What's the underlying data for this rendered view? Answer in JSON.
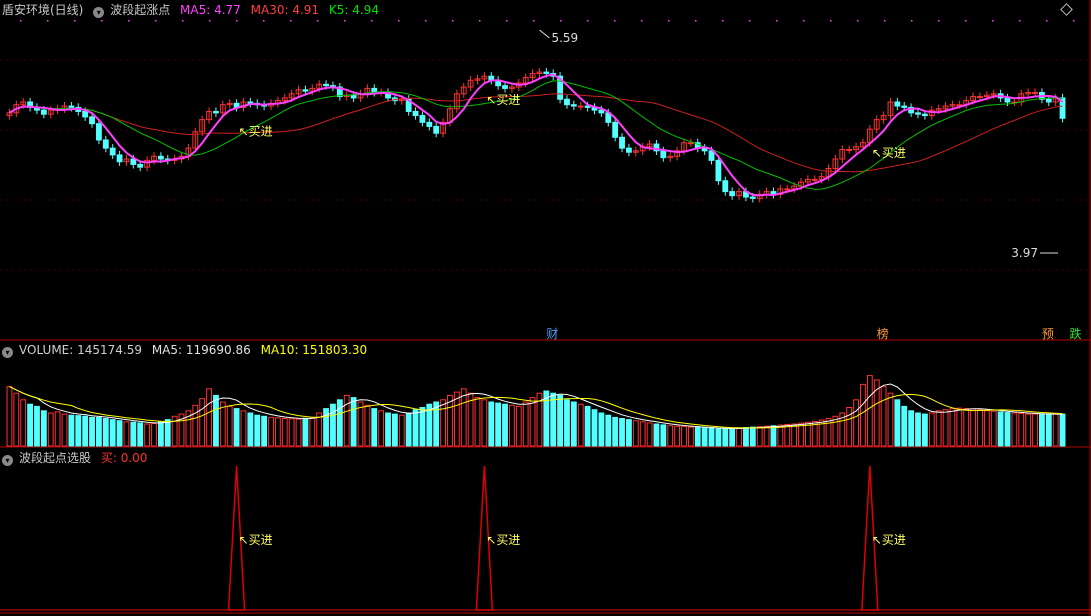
{
  "panels": {
    "main": {
      "stock_name": "盾安环境(日线)",
      "indicator_name": "波段起涨点",
      "ma5_label": "MA5: 4.77",
      "ma30_label": "MA30: 4.91",
      "k5_label": "K5: 4.94",
      "high_label": "5.59",
      "low_label": "3.97",
      "buy_label": "买进",
      "event_markers": [
        "财",
        "榜",
        "预",
        "跌"
      ]
    },
    "volume": {
      "vol_label": "VOLUME: 145174.59",
      "ma5_label": "MA5: 119690.86",
      "ma10_label": "MA10: 151803.30"
    },
    "signal": {
      "indicator_name": "波段起点选股",
      "value_label": "买: 0.00",
      "buy_label": "买进"
    }
  },
  "colors": {
    "up": "#ff3232",
    "down": "#54ffff",
    "ma5": "#ff40ff",
    "ma30": "#cc2020",
    "k5": "#00c000",
    "vol_ma5": "#ffffff",
    "vol_ma10": "#ffff00",
    "signal": "#e00000",
    "border": "#b40000"
  },
  "chart_data": {
    "type": "candlestick",
    "price_range": [
      3.97,
      5.59
    ],
    "price_high": 5.59,
    "price_low": 3.97,
    "volume_range": [
      0,
      400000
    ],
    "signal_range": [
      0,
      1
    ],
    "buy_signal_indices": [
      33,
      69,
      125
    ],
    "event_marker_indices": [
      78,
      126,
      150,
      154
    ],
    "closes": [
      4.98,
      5.04,
      5.06,
      5.02,
      5.0,
      4.97,
      5.0,
      5.01,
      5.03,
      5.02,
      4.99,
      4.95,
      4.9,
      4.78,
      4.72,
      4.67,
      4.62,
      4.64,
      4.6,
      4.58,
      4.63,
      4.66,
      4.64,
      4.63,
      4.64,
      4.66,
      4.72,
      4.84,
      4.93,
      4.99,
      4.98,
      5.04,
      5.05,
      5.02,
      5.06,
      5.05,
      5.04,
      5.03,
      5.05,
      5.07,
      5.09,
      5.12,
      5.15,
      5.14,
      5.16,
      5.19,
      5.18,
      5.17,
      5.1,
      5.11,
      5.09,
      5.12,
      5.16,
      5.13,
      5.13,
      5.09,
      5.07,
      5.08,
      4.99,
      4.96,
      4.91,
      4.88,
      4.83,
      4.91,
      5.01,
      5.12,
      5.17,
      5.22,
      5.23,
      5.25,
      5.22,
      5.18,
      5.16,
      5.17,
      5.2,
      5.24,
      5.27,
      5.28,
      5.27,
      5.25,
      5.08,
      5.04,
      5.03,
      5.03,
      5.02,
      5.0,
      4.98,
      4.91,
      4.8,
      4.72,
      4.69,
      4.7,
      4.73,
      4.75,
      4.7,
      4.65,
      4.66,
      4.7,
      4.76,
      4.76,
      4.72,
      4.7,
      4.63,
      4.48,
      4.4,
      4.37,
      4.4,
      4.36,
      4.35,
      4.38,
      4.4,
      4.38,
      4.42,
      4.42,
      4.44,
      4.47,
      4.49,
      4.49,
      4.51,
      4.57,
      4.64,
      4.71,
      4.71,
      4.73,
      4.76,
      4.86,
      4.93,
      4.96,
      5.06,
      5.03,
      5.02,
      4.98,
      4.97,
      4.96,
      5.0,
      5.01,
      5.03,
      5.04,
      5.04,
      5.07,
      5.1,
      5.1,
      5.11,
      5.12,
      5.09,
      5.06,
      5.06,
      5.12,
      5.13,
      5.13,
      5.08,
      5.06,
      5.09,
      4.94
    ],
    "volumes": [
      270000,
      240000,
      210000,
      190000,
      180000,
      160000,
      150000,
      155000,
      145000,
      140000,
      138000,
      135000,
      130000,
      130000,
      125000,
      120000,
      115000,
      110000,
      108000,
      105000,
      100000,
      102000,
      110000,
      120000,
      135000,
      145000,
      160000,
      185000,
      215000,
      260000,
      230000,
      200000,
      180000,
      170000,
      160000,
      150000,
      140000,
      135000,
      130000,
      128000,
      125000,
      124000,
      122000,
      126000,
      130000,
      150000,
      170000,
      190000,
      210000,
      230000,
      220000,
      200000,
      185000,
      170000,
      160000,
      150000,
      145000,
      140000,
      150000,
      165000,
      175000,
      190000,
      200000,
      210000,
      230000,
      245000,
      260000,
      240000,
      220000,
      210000,
      200000,
      195000,
      190000,
      185000,
      180000,
      200000,
      220000,
      240000,
      250000,
      240000,
      230000,
      210000,
      200000,
      190000,
      180000,
      165000,
      150000,
      140000,
      130000,
      125000,
      120000,
      115000,
      110000,
      105000,
      100000,
      96000,
      92000,
      90000,
      88000,
      86000,
      84000,
      82000,
      80000,
      78000,
      78000,
      80000,
      82000,
      84000,
      86000,
      88000,
      90000,
      92000,
      95000,
      98000,
      100000,
      104000,
      108000,
      112000,
      118000,
      125000,
      135000,
      150000,
      175000,
      210000,
      280000,
      320000,
      300000,
      270000,
      240000,
      210000,
      180000,
      160000,
      150000,
      145000,
      150000,
      160000,
      165000,
      170000,
      172000,
      170000,
      168000,
      165000,
      160000,
      158000,
      155000,
      152000,
      150000,
      148000,
      145000,
      145000,
      145000,
      145000,
      145000,
      145000
    ]
  }
}
